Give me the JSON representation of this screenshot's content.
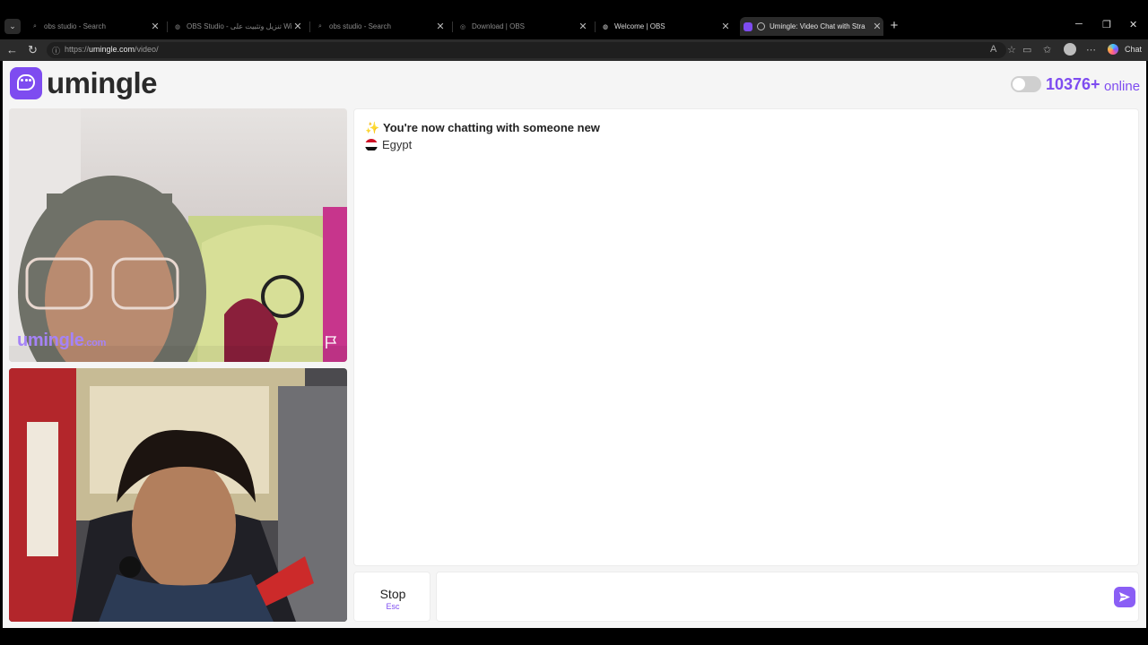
{
  "browser": {
    "tabs": [
      {
        "title": "obs studio - Search",
        "active": false
      },
      {
        "title": "OBS Studio - تنزيل وتثبيت على Wi",
        "active": false
      },
      {
        "title": "obs studio - Search",
        "active": false
      },
      {
        "title": "Download | OBS",
        "active": false
      },
      {
        "title": "Welcome | OBS",
        "active": false
      },
      {
        "title": "Umingle: Video Chat with Stra",
        "active": true
      }
    ],
    "url_prefix": "https://",
    "url_host": "umingle.com",
    "url_path": "/video/",
    "chat_label": "Chat"
  },
  "header": {
    "logo_text": "umingle",
    "online_count": "10376+",
    "online_label": "online",
    "accent_color": "#7e4cf0"
  },
  "stranger_video": {
    "watermark": "umingle",
    "watermark_suffix": ".com"
  },
  "chat": {
    "system_message": "You're now chatting with someone new",
    "country": "Egypt"
  },
  "controls": {
    "stop_label": "Stop",
    "stop_shortcut": "Esc",
    "message_placeholder": ""
  },
  "icons": {
    "logo": "chat-bubble-icon",
    "sparkle": "sparkle-icon",
    "flag": "egypt-flag-icon",
    "report": "report-flag-icon",
    "send": "send-icon"
  }
}
